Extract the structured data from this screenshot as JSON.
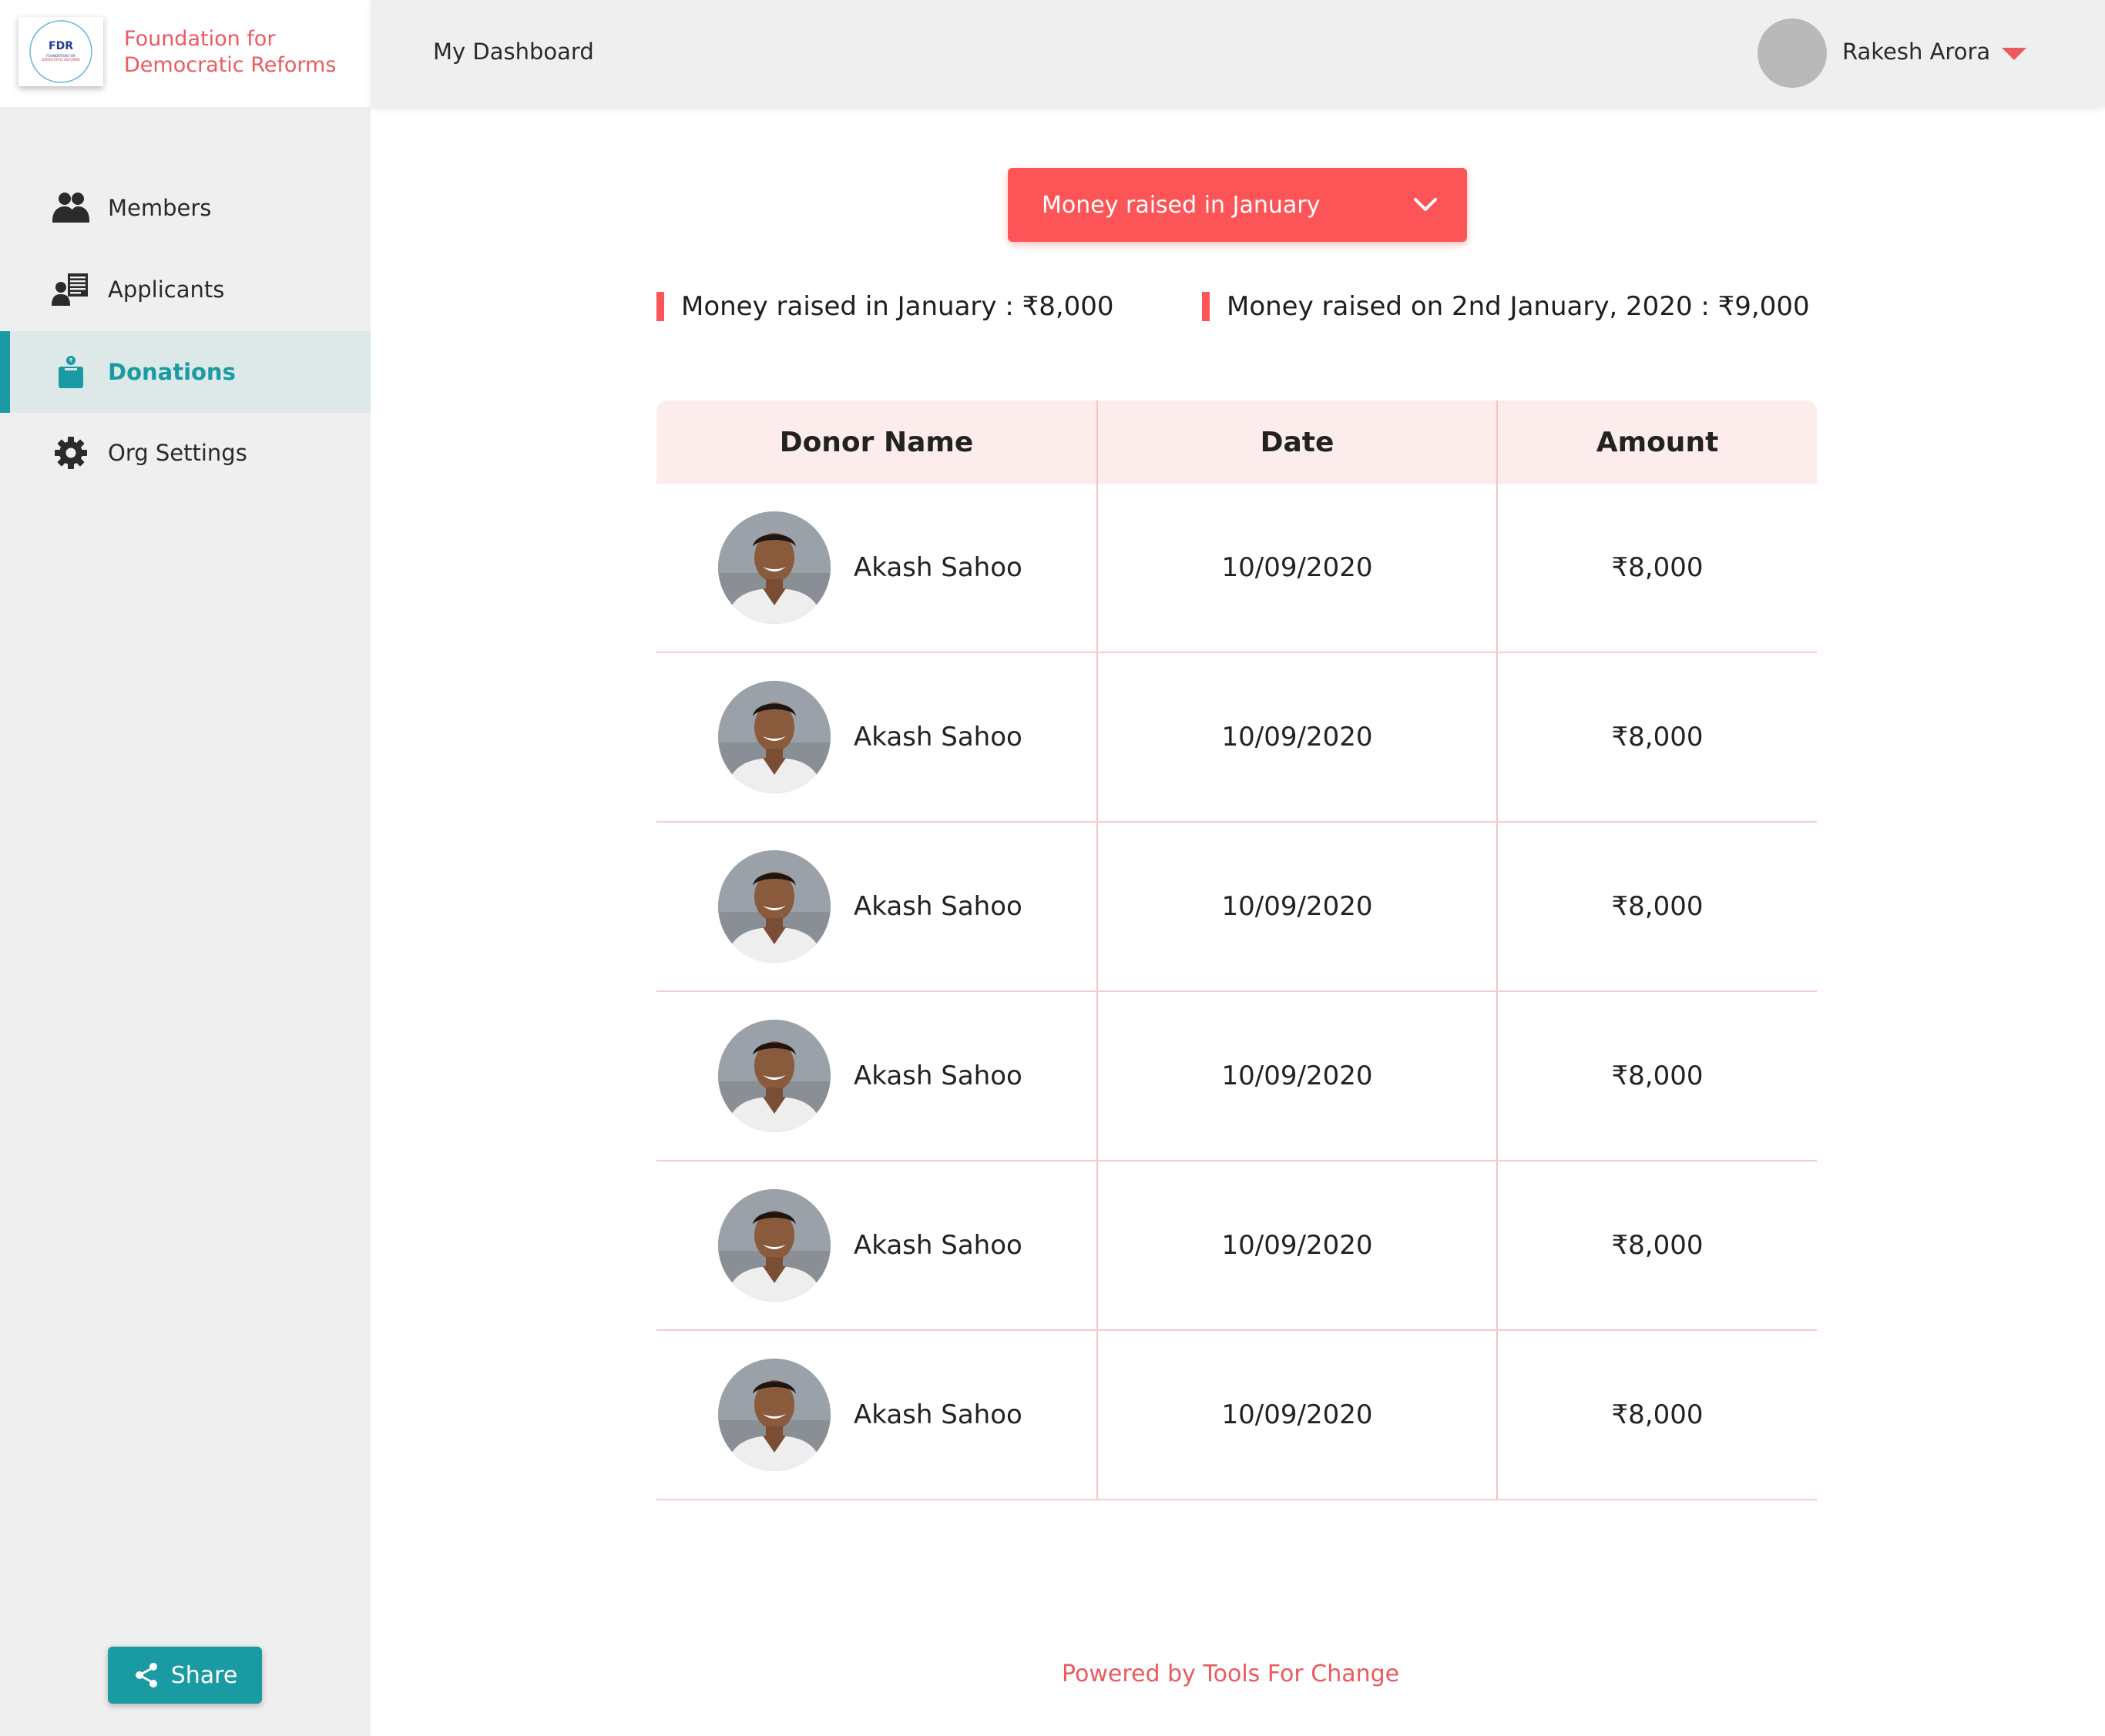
{
  "brand": {
    "logo_text": "FDR",
    "logo_subtext": "FOUNDATION FOR DEMOCRATIC REFORMS",
    "name_line1": "Foundation for",
    "name_line2": "Democratic Reforms"
  },
  "header": {
    "title": "My Dashboard",
    "user_name": "Rakesh Arora"
  },
  "sidebar": {
    "items": [
      {
        "label": "Members",
        "icon": "members-icon",
        "active": false
      },
      {
        "label": "Applicants",
        "icon": "applicants-icon",
        "active": false
      },
      {
        "label": "Donations",
        "icon": "donations-icon",
        "active": true
      },
      {
        "label": "Org Settings",
        "icon": "gear-icon",
        "active": false
      }
    ],
    "share_label": "Share"
  },
  "filter": {
    "selected": "Money raised in January"
  },
  "stats": [
    {
      "text": "Money raised in January : ₹8,000"
    },
    {
      "text": "Money raised on 2nd January, 2020 : ₹9,000"
    }
  ],
  "table": {
    "headers": [
      "Donor Name",
      "Date",
      "Amount"
    ],
    "rows": [
      {
        "name": "Akash Sahoo",
        "date": "10/09/2020",
        "amount": "₹8,000"
      },
      {
        "name": "Akash Sahoo",
        "date": "10/09/2020",
        "amount": "₹8,000"
      },
      {
        "name": "Akash Sahoo",
        "date": "10/09/2020",
        "amount": "₹8,000"
      },
      {
        "name": "Akash Sahoo",
        "date": "10/09/2020",
        "amount": "₹8,000"
      },
      {
        "name": "Akash Sahoo",
        "date": "10/09/2020",
        "amount": "₹8,000"
      },
      {
        "name": "Akash Sahoo",
        "date": "10/09/2020",
        "amount": "₹8,000"
      }
    ]
  },
  "footer": {
    "powered_by": "Powered by Tools For Change"
  },
  "colors": {
    "accent_red": "#fd5457",
    "brand_red": "#ea5a5f",
    "teal": "#1a9aa3",
    "sidebar_bg": "#efefef",
    "table_head_bg": "#fdecec"
  }
}
